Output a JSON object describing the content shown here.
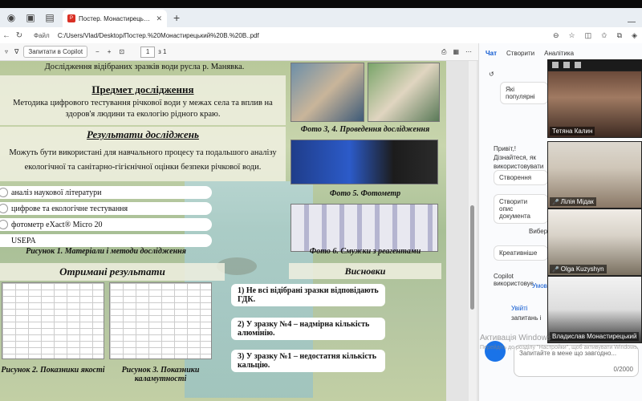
{
  "browser": {
    "tab_title": "Постер. Монастирецький Б. В.pdf",
    "tab_icon": "pdf-icon",
    "addr_label": "Файл",
    "url": "C:/Users/Vlad/Desktop/Постер.%20Монастирецький%20В.%20В..pdf"
  },
  "pdf_toolbar": {
    "copilot_btn": "Запитати в Copilot",
    "page_current": "1",
    "page_total": "з 1"
  },
  "poster": {
    "top_line": "Дослідження відібраних зразків води русла р. Манявка.",
    "subject_title": "Предмет дослідження",
    "subject_text": "Методика цифрового тестування річкової води у межах села та вплив на здоров'я людини та екологію рідного краю.",
    "results_title": "Результати досліджень",
    "results_text": "Можуть бути використані для навчального процесу та подальшого аналізу екологічної та санітарно-гігієнічної оцінки безпеки річкової води.",
    "methods": [
      "аналіз наукової літератури",
      "цифрове та екологічне тестування",
      "фотометр eXact® Micro 20",
      "USEPA"
    ],
    "fig1": "Рисунок 1. Матеріали і методи дослідження",
    "obtained_title": "Отримані результати",
    "fig2": "Рисунок 2. Показники якості",
    "fig3": "Рисунок 3. Показники каламутності",
    "photo34": "Фото 3, 4. Проведення дослідження",
    "photo5": "Фото 5. Фотометр",
    "photo6": "Фото 6. Смужки з реагентами",
    "conclusions_title": "Висновки",
    "conclusions": [
      "1) Не всі відібрані зразки відповідають ГДК.",
      "2) У зразку №4 – надмірна кількість алюмінію.",
      "3) У зразку №1 – недостатня кількість кальцію."
    ]
  },
  "copilot": {
    "tabs": [
      "Чат",
      "Створити",
      "Аналітика"
    ],
    "popular": "Які популярні",
    "greeting": "Привіт,! Дізнайтеся, як використовувати Copilot в Edge",
    "card1": "Створення",
    "card2": "Створити опис документа",
    "more": "Вибер",
    "style_btn": "Креативніше",
    "footer": "Copilot використовує",
    "footer2": "Умови",
    "sign_in": "Увійті",
    "sign_in2": "запитань і",
    "input_placeholder": "Запитайте в мене що завгодно...",
    "char_count": "0/2000",
    "watermark": "Активація Windows",
    "watermark2": "Перейдіть до розділу \"Настройки\", щоб активувати Windows."
  },
  "participants": [
    {
      "name": "Тетяна Калин",
      "muted": false
    },
    {
      "name": "Лілія Мідак",
      "muted": true
    },
    {
      "name": "Olga Kuzyshyn",
      "muted": true
    },
    {
      "name": "Владислав Монастирецький",
      "muted": false
    }
  ]
}
